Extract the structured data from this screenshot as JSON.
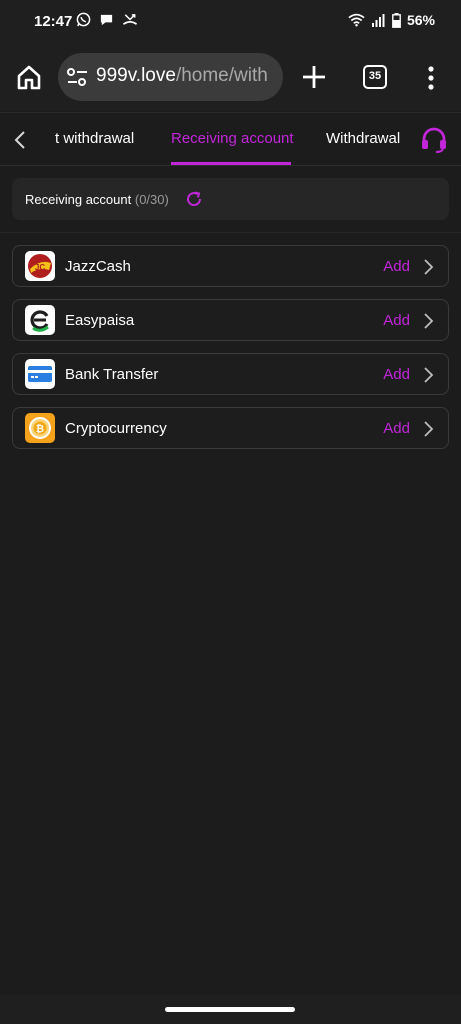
{
  "status": {
    "time": "12:47",
    "battery": "56%",
    "left_icons": [
      "whatsapp-icon",
      "chat-bubble-icon",
      "missed-call-icon"
    ],
    "right_icons": [
      "wifi-icon",
      "signal-icon",
      "battery-icon"
    ]
  },
  "browser": {
    "url_host": "999v.love",
    "url_path": "/home/with",
    "tab_count": "35"
  },
  "tabs": {
    "items": [
      {
        "label": "t withdrawal"
      },
      {
        "label": "Receiving account"
      },
      {
        "label": "Withdrawal history"
      }
    ],
    "active_index": 1
  },
  "account": {
    "label": "Receiving account",
    "count": "(0/30)"
  },
  "methods": [
    {
      "name": "JazzCash",
      "action": "Add",
      "icon": "jazzcash-icon"
    },
    {
      "name": "Easypaisa",
      "action": "Add",
      "icon": "easypaisa-icon"
    },
    {
      "name": "Bank Transfer",
      "action": "Add",
      "icon": "bank-card-icon"
    },
    {
      "name": "Cryptocurrency",
      "action": "Add",
      "icon": "crypto-coin-icon"
    }
  ],
  "colors": {
    "accent": "#c226d9",
    "background": "#1c1c1c",
    "card": "#262626"
  }
}
